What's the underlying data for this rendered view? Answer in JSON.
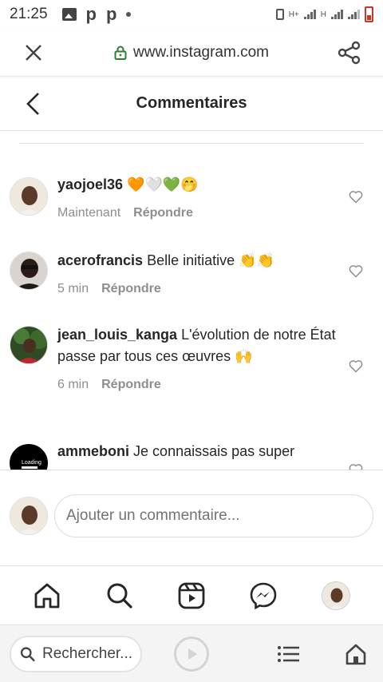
{
  "status_bar": {
    "time": "21:25",
    "left_icons": [
      "gallery-icon",
      "p-icon",
      "p-icon",
      "dot-icon"
    ],
    "right_icons": [
      "vibrate-icon",
      "signal-h-plus-icon",
      "signal-h-icon",
      "signal-icon",
      "battery-low-icon"
    ],
    "network_labels": [
      "H+",
      "H"
    ],
    "battery_color": "#c0392b"
  },
  "browser": {
    "url": "www.instagram.com",
    "close_icon": "close-icon",
    "lock_icon": "lock-icon",
    "share_icon": "share-icon",
    "lock_color": "#2e7d32"
  },
  "header": {
    "title": "Commentaires",
    "back_icon": "chevron-left-icon"
  },
  "comments": [
    {
      "username": "yaojoel36",
      "text": "",
      "emojis": [
        "🧡",
        "🤍",
        "💚",
        "🤭"
      ],
      "time": "Maintenant",
      "reply": "Répondre"
    },
    {
      "username": "acerofrancis",
      "text": "Belle initiative",
      "emojis": [
        "👏",
        "👏"
      ],
      "time": "5 min",
      "reply": "Répondre"
    },
    {
      "username": "jean_louis_kanga",
      "text": "L'évolution de notre État passe par tous ces œuvres",
      "emojis": [
        "🙌"
      ],
      "time": "6 min",
      "reply": "Répondre"
    },
    {
      "username": "ammeboni",
      "text": "Je connaissais pas super",
      "emojis": [],
      "time": "",
      "reply": "",
      "avatar_text": "Loading"
    }
  ],
  "add_comment": {
    "placeholder": "Ajouter un commentaire..."
  },
  "ig_nav": [
    "home-icon",
    "search-icon",
    "reels-icon",
    "messenger-icon",
    "profile-avatar"
  ],
  "browser_bottom": {
    "search_label": "Rechercher...",
    "icons": [
      "search-icon",
      "play-icon",
      "list-icon",
      "home-icon"
    ]
  }
}
